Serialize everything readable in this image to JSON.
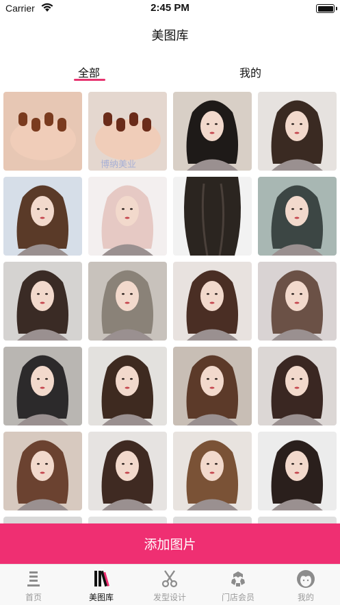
{
  "status_bar": {
    "carrier": "Carrier",
    "time": "2:45 PM"
  },
  "nav": {
    "title": "美图库"
  },
  "tabs": [
    {
      "label": "全部",
      "active": true
    },
    {
      "label": "我的",
      "active": false
    }
  ],
  "gallery": {
    "watermark": "博纳美业",
    "items": [
      {
        "bg": "#e7c7b4",
        "fg": "#7a3b1f",
        "subject": "nails"
      },
      {
        "bg": "#e4d7cf",
        "fg": "#6b2c1a",
        "subject": "nails"
      },
      {
        "bg": "#d8cfc6",
        "fg": "#1e1a18",
        "subject": "portrait"
      },
      {
        "bg": "#e6e2df",
        "fg": "#3a2a22",
        "subject": "portrait"
      },
      {
        "bg": "#d6dee8",
        "fg": "#5a3a28",
        "subject": "portrait"
      },
      {
        "bg": "#f3efef",
        "fg": "#e6c9c4",
        "subject": "portrait"
      },
      {
        "bg": "#f2f2f2",
        "fg": "#2b2520",
        "subject": "hair"
      },
      {
        "bg": "#a8b7b3",
        "fg": "#3c4644",
        "subject": "portrait"
      },
      {
        "bg": "#d5d3d1",
        "fg": "#3a2b25",
        "subject": "portrait"
      },
      {
        "bg": "#c8c2bc",
        "fg": "#8a8278",
        "subject": "portrait"
      },
      {
        "bg": "#e8e2df",
        "fg": "#4a2e24",
        "subject": "portrait"
      },
      {
        "bg": "#d9d3d3",
        "fg": "#6b5146",
        "subject": "portrait"
      },
      {
        "bg": "#b9b6b2",
        "fg": "#2c2a2b",
        "subject": "portrait"
      },
      {
        "bg": "#e3e1de",
        "fg": "#3e2a20",
        "subject": "portrait"
      },
      {
        "bg": "#c8beb5",
        "fg": "#5c3a29",
        "subject": "portrait"
      },
      {
        "bg": "#dcd7d5",
        "fg": "#3a2722",
        "subject": "portrait"
      },
      {
        "bg": "#d7c9bf",
        "fg": "#6b4230",
        "subject": "portrait"
      },
      {
        "bg": "#e6e3e1",
        "fg": "#3f2a22",
        "subject": "portrait"
      },
      {
        "bg": "#e8e3df",
        "fg": "#7a5236",
        "subject": "portrait"
      },
      {
        "bg": "#ececec",
        "fg": "#2a1f1c",
        "subject": "portrait"
      },
      {
        "bg": "#d8d8d8",
        "fg": "#3a2b25",
        "subject": "portrait"
      },
      {
        "bg": "#e3e3e3",
        "fg": "#3a2b25",
        "subject": "portrait"
      },
      {
        "bg": "#dcdcdc",
        "fg": "#3a2b25",
        "subject": "portrait"
      },
      {
        "bg": "#e0e0e0",
        "fg": "#3a2b25",
        "subject": "portrait"
      }
    ]
  },
  "add_button": {
    "label": "添加图片",
    "color": "#ef2f72"
  },
  "tabbar": [
    {
      "label": "首页",
      "icon": "home-icon",
      "active": false
    },
    {
      "label": "美图库",
      "icon": "gallery-icon",
      "active": true
    },
    {
      "label": "发型设计",
      "icon": "scissors-icon",
      "active": false
    },
    {
      "label": "门店会员",
      "icon": "members-icon",
      "active": false
    },
    {
      "label": "我的",
      "icon": "profile-icon",
      "active": false
    }
  ],
  "colors": {
    "accent": "#ef2f72",
    "tab_underline": "#e6336f"
  }
}
